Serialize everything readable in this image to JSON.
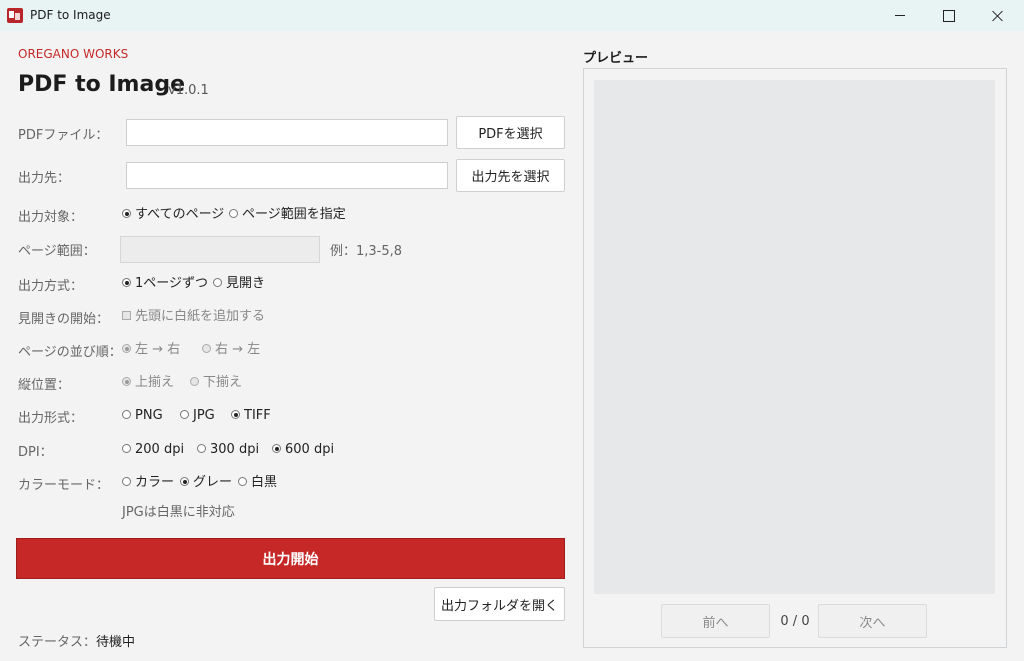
{
  "window": {
    "title": "PDF to Image"
  },
  "header": {
    "brand": "OREGANO WORKS",
    "title": "PDF to Image",
    "version": "v1.0.1"
  },
  "form": {
    "pdf_file": {
      "label": "PDFファイル：",
      "value": "",
      "button": "PDFを選択"
    },
    "output_dir": {
      "label": "出力先：",
      "value": "",
      "button": "出力先を選択"
    },
    "target": {
      "label": "出力対象：",
      "options": [
        "すべてのページ",
        "ページ範囲を指定"
      ],
      "selected": "すべてのページ"
    },
    "page_range": {
      "label": "ページ範囲：",
      "value": "",
      "hint": "例：1,3-5,8"
    },
    "mode": {
      "label": "出力方式：",
      "options": [
        "1ページずつ",
        "見開き"
      ],
      "selected": "1ページずつ"
    },
    "spread_start": {
      "label": "見開きの開始：",
      "checkbox_label": "先頭に白紙を追加する",
      "checked": false
    },
    "page_order": {
      "label": "ページの並び順：",
      "options": [
        "左 → 右",
        "右 → 左"
      ],
      "selected": "左 → 右"
    },
    "vertical_align": {
      "label": "縦位置：",
      "options": [
        "上揃え",
        "下揃え"
      ],
      "selected": "上揃え"
    },
    "format": {
      "label": "出力形式：",
      "options": [
        "PNG",
        "JPG",
        "TIFF"
      ],
      "selected": "TIFF"
    },
    "dpi": {
      "label": "DPI：",
      "options": [
        "200 dpi",
        "300 dpi",
        "600 dpi"
      ],
      "selected": "600 dpi"
    },
    "color_mode": {
      "label": "カラーモード：",
      "options": [
        "カラー",
        "グレー",
        "白黒"
      ],
      "selected": "グレー",
      "note": "JPGは白黒に非対応"
    }
  },
  "actions": {
    "start": "出力開始",
    "open_folder": "出力フォルダを開く"
  },
  "status": {
    "label": "ステータス：",
    "value": "待機中"
  },
  "preview": {
    "label": "プレビュー",
    "prev": "前へ",
    "next": "次へ",
    "page_count": "0 / 0"
  },
  "colors": {
    "accent": "#c62828",
    "titlebar": "#e8f3f4",
    "background": "#f3f3f3"
  }
}
